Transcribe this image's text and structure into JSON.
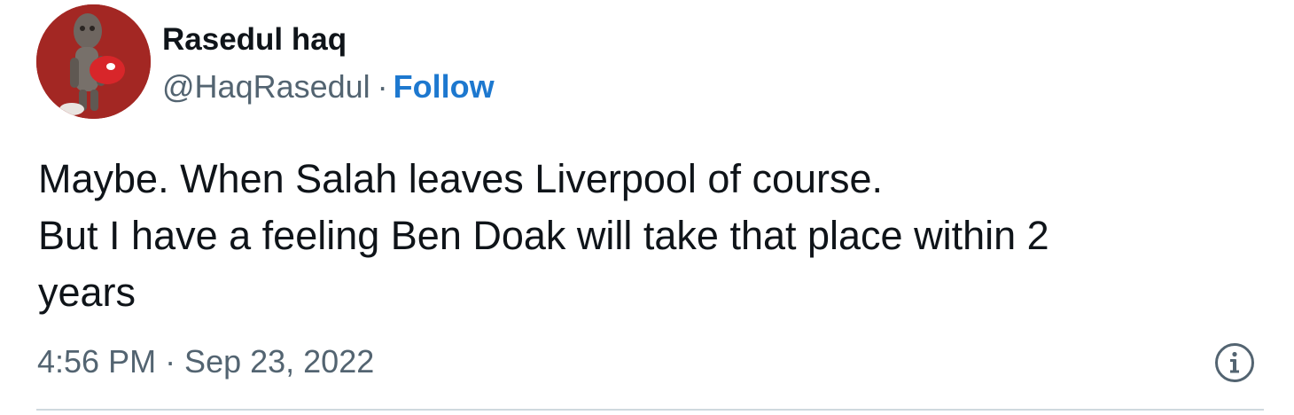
{
  "tweet": {
    "author": {
      "display_name": "Rasedul haq",
      "handle": "@HaqRasedul",
      "avatar_icon": "groot-avatar-icon"
    },
    "separator": "·",
    "follow_label": "Follow",
    "text_lines": [
      "Maybe. When Salah leaves Liverpool of course.",
      "But I have a feeling Ben Doak will take that place within 2",
      "years"
    ],
    "timestamp": "4:56 PM · Sep 23, 2022",
    "info_icon": "info-icon"
  },
  "colors": {
    "text": "#0f1419",
    "secondary": "#536471",
    "link": "#1d78cf",
    "divider": "#cfd9de",
    "avatar_bg": "#9c2522"
  }
}
